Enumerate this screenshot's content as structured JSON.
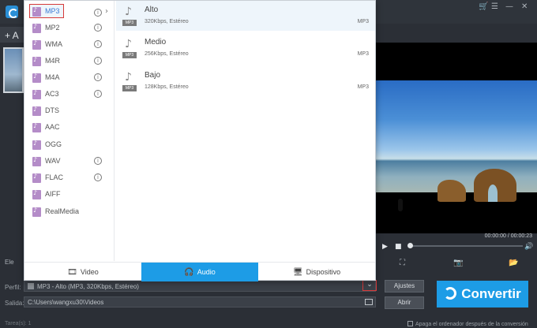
{
  "window": {
    "controls": [
      "🛒",
      "☰",
      "—",
      "✕"
    ]
  },
  "left_panel": {
    "add_label": "+ A",
    "side_text": "Ele"
  },
  "formats": {
    "selected": "MP3",
    "items": [
      {
        "label": "MP3",
        "info": true
      },
      {
        "label": "MP2",
        "info": true
      },
      {
        "label": "WMA",
        "info": true
      },
      {
        "label": "M4R",
        "info": true
      },
      {
        "label": "M4A",
        "info": true
      },
      {
        "label": "AC3",
        "info": true
      },
      {
        "label": "DTS",
        "info": false
      },
      {
        "label": "AAC",
        "info": false
      },
      {
        "label": "OGG",
        "info": false
      },
      {
        "label": "WAV",
        "info": true
      },
      {
        "label": "FLAC",
        "info": true
      },
      {
        "label": "AIFF",
        "info": false
      },
      {
        "label": "RealMedia",
        "info": false
      }
    ]
  },
  "qualities": [
    {
      "name": "Alto",
      "desc": "320Kbps, Estéreo",
      "format": "MP3",
      "tag": "MP3"
    },
    {
      "name": "Medio",
      "desc": "256Kbps, Estéreo",
      "format": "MP3",
      "tag": "MP3"
    },
    {
      "name": "Bajo",
      "desc": "128Kbps, Estéreo",
      "format": "MP3",
      "tag": "MP3"
    }
  ],
  "tabs": [
    {
      "label": "Video",
      "icon": "film-reel-icon",
      "glyph": "🎞",
      "active": false
    },
    {
      "label": "Audio",
      "icon": "headphones-icon",
      "glyph": "🎧",
      "active": true
    },
    {
      "label": "Dispositivo",
      "icon": "device-icon",
      "glyph": "🖥",
      "active": false
    }
  ],
  "player": {
    "timecode": "00:00:00 / 00:00:23",
    "progress": 0.0
  },
  "output": {
    "profile_label": "Perfil:",
    "profile_value": "MP3 - Alto (MP3, 320Kbps, Estéreo)",
    "output_label": "Salida:",
    "output_value": "C:\\Users\\wangxu30\\Videos",
    "settings_button": "Ajustes",
    "open_button": "Abrir",
    "convert_button": "Convertir",
    "shutdown_label": "Apaga el ordenador después de la conversión",
    "footer_left": "Tarea(s): 1"
  },
  "colors": {
    "accent": "#1d9ce6",
    "highlight_border": "#d63a3a",
    "format_icon": "#b48cc8"
  }
}
